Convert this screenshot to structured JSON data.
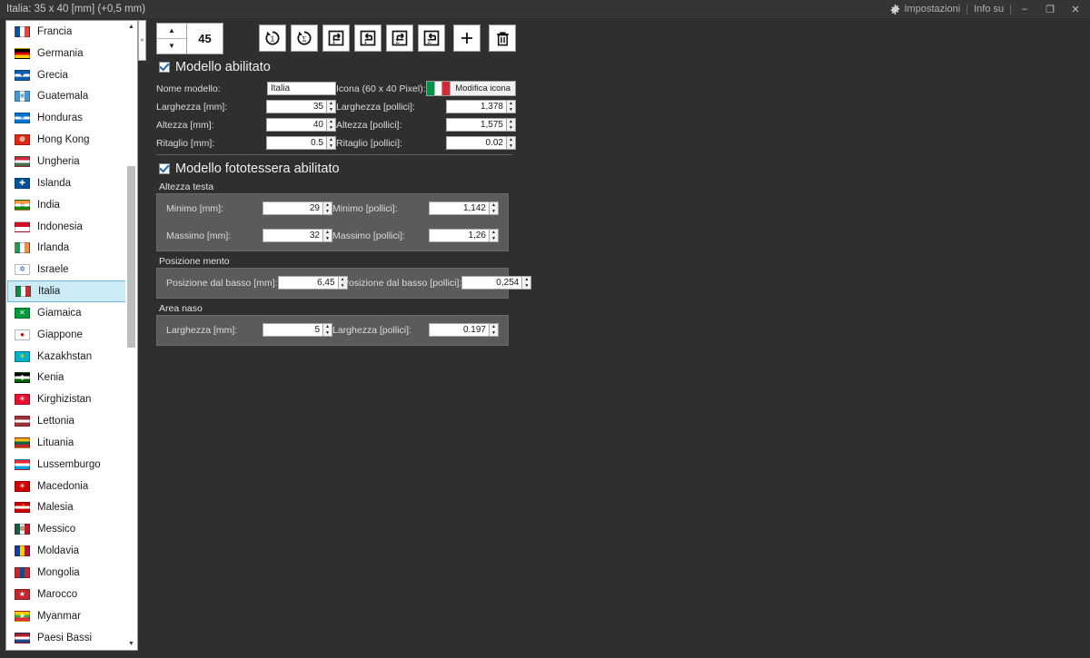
{
  "titlebar": {
    "title": "Italia: 35 x 40 [mm] (+0,5 mm)",
    "settings_label": "Impostazioni",
    "about_label": "Info su",
    "separator": "|",
    "minimize": "–",
    "restore": "❐",
    "close": "✕",
    "gear_icon": "gear-icon"
  },
  "toolbar": {
    "spinner_value": "45",
    "spin_up": "▲",
    "spin_down": "▼",
    "icons": [
      {
        "name": "reset-single-icon",
        "glyph": "reset-1"
      },
      {
        "name": "reset-all-icon",
        "glyph": "reset-sigma"
      },
      {
        "name": "export-single-icon",
        "glyph": "export-1"
      },
      {
        "name": "import-single-icon",
        "glyph": "import-1"
      },
      {
        "name": "export-all-icon",
        "glyph": "export-sigma"
      },
      {
        "name": "import-all-icon",
        "glyph": "import-sigma"
      },
      {
        "name": "add-icon",
        "glyph": "plus"
      },
      {
        "name": "delete-icon",
        "glyph": "trash"
      }
    ]
  },
  "sidebar": {
    "scroll_up": "▲",
    "scroll_down": "▼",
    "splitter_glyph": "«",
    "selected": "Italia",
    "items": [
      {
        "label": "Francia",
        "flag": "vstripe3",
        "c1": "#0055a4",
        "c2": "#ffffff",
        "c3": "#ef4135",
        "mark": ""
      },
      {
        "label": "Germania",
        "flag": "hstripe3",
        "c1": "#000000",
        "c2": "#dd0000",
        "c3": "#ffce00",
        "mark": ""
      },
      {
        "label": "Grecia",
        "flag": "hstripe3",
        "c1": "#0d5eaf",
        "c2": "#ffffff",
        "c3": "#0d5eaf",
        "mark": "✦"
      },
      {
        "label": "Guatemala",
        "flag": "vstripe3",
        "c1": "#4997d0",
        "c2": "#ffffff",
        "c3": "#4997d0",
        "mark": "❀"
      },
      {
        "label": "Honduras",
        "flag": "hstripe3",
        "c1": "#0073cf",
        "c2": "#ffffff",
        "c3": "#0073cf",
        "mark": "✳"
      },
      {
        "label": "Hong Kong",
        "flag": "plain",
        "c1": "#de2910",
        "c2": "#de2910",
        "c3": "#de2910",
        "mark": "❁"
      },
      {
        "label": "Ungheria",
        "flag": "hstripe3",
        "c1": "#cd2a3e",
        "c2": "#ffffff",
        "c3": "#436f4d",
        "mark": ""
      },
      {
        "label": "Islanda",
        "flag": "plain",
        "c1": "#02529c",
        "c2": "#02529c",
        "c3": "#02529c",
        "mark": "✚"
      },
      {
        "label": "India",
        "flag": "hstripe3",
        "c1": "#ff9933",
        "c2": "#ffffff",
        "c3": "#138808",
        "mark": "○"
      },
      {
        "label": "Indonesia",
        "flag": "hstripe2",
        "c1": "#ce1126",
        "c2": "#ffffff",
        "c3": "#ffffff",
        "mark": ""
      },
      {
        "label": "Irlanda",
        "flag": "vstripe3",
        "c1": "#169b62",
        "c2": "#ffffff",
        "c3": "#ff883e",
        "mark": ""
      },
      {
        "label": "Israele",
        "flag": "hstripe3",
        "c1": "#ffffff",
        "c2": "#ffffff",
        "c3": "#ffffff",
        "mark": "✡"
      },
      {
        "label": "Italia",
        "flag": "vstripe3",
        "c1": "#009246",
        "c2": "#ffffff",
        "c3": "#ce2b37",
        "mark": ""
      },
      {
        "label": "Giamaica",
        "flag": "plain",
        "c1": "#009b3a",
        "c2": "#009b3a",
        "c3": "#009b3a",
        "mark": "✕"
      },
      {
        "label": "Giappone",
        "flag": "plain",
        "c1": "#ffffff",
        "c2": "#ffffff",
        "c3": "#ffffff",
        "mark": "●"
      },
      {
        "label": "Kazakhstan",
        "flag": "plain",
        "c1": "#00afca",
        "c2": "#00afca",
        "c3": "#00afca",
        "mark": "☀"
      },
      {
        "label": "Kenia",
        "flag": "hstripe3",
        "c1": "#000000",
        "c2": "#ffffff",
        "c3": "#006600",
        "mark": "◆"
      },
      {
        "label": "Kirghizistan",
        "flag": "plain",
        "c1": "#e8112d",
        "c2": "#e8112d",
        "c3": "#e8112d",
        "mark": "☀"
      },
      {
        "label": "Lettonia",
        "flag": "hstripe3",
        "c1": "#9e3039",
        "c2": "#ffffff",
        "c3": "#9e3039",
        "mark": ""
      },
      {
        "label": "Lituania",
        "flag": "hstripe3",
        "c1": "#fdb913",
        "c2": "#006a44",
        "c3": "#c1272d",
        "mark": ""
      },
      {
        "label": "Lussemburgo",
        "flag": "hstripe3",
        "c1": "#ed2939",
        "c2": "#ffffff",
        "c3": "#00a1de",
        "mark": ""
      },
      {
        "label": "Macedonia",
        "flag": "plain",
        "c1": "#d20000",
        "c2": "#d20000",
        "c3": "#d20000",
        "mark": "☀"
      },
      {
        "label": "Malesia",
        "flag": "hstripe3",
        "c1": "#cc0001",
        "c2": "#ffffff",
        "c3": "#cc0001",
        "mark": "☽"
      },
      {
        "label": "Messico",
        "flag": "vstripe3",
        "c1": "#006847",
        "c2": "#ffffff",
        "c3": "#ce1126",
        "mark": "❁"
      },
      {
        "label": "Moldavia",
        "flag": "vstripe3",
        "c1": "#0046ae",
        "c2": "#ffd200",
        "c3": "#cc092f",
        "mark": ""
      },
      {
        "label": "Mongolia",
        "flag": "vstripe3",
        "c1": "#c4272f",
        "c2": "#015197",
        "c3": "#c4272f",
        "mark": ""
      },
      {
        "label": "Marocco",
        "flag": "plain",
        "c1": "#c1272d",
        "c2": "#c1272d",
        "c3": "#c1272d",
        "mark": "★"
      },
      {
        "label": "Myanmar",
        "flag": "hstripe3",
        "c1": "#fecb00",
        "c2": "#34b233",
        "c3": "#ea2839",
        "mark": "★"
      },
      {
        "label": "Paesi Bassi",
        "flag": "hstripe3",
        "c1": "#ae1c28",
        "c2": "#ffffff",
        "c3": "#21468b",
        "mark": ""
      }
    ]
  },
  "form": {
    "model_enabled": {
      "label": "Modello abilitato",
      "checked": true
    },
    "fields_left": [
      {
        "name": "nome-modello",
        "label": "Nome modello:",
        "value": "Italia",
        "type": "text"
      },
      {
        "name": "larghezza-mm",
        "label": "Larghezza [mm]:",
        "value": "35",
        "type": "number"
      },
      {
        "name": "altezza-mm",
        "label": "Altezza [mm]:",
        "value": "40",
        "type": "number"
      },
      {
        "name": "ritaglio-mm",
        "label": "Ritaglio [mm]:",
        "value": "0.5",
        "type": "number"
      }
    ],
    "icon_field": {
      "label": "Icona (60 x 40 Pixel):",
      "button_label": "Modifica icona",
      "preview": "flag-italy-icon"
    },
    "fields_right": [
      {
        "name": "larghezza-pollici",
        "label": "Larghezza [pollici]:",
        "value": "1,378"
      },
      {
        "name": "altezza-pollici",
        "label": "Altezza [pollici]:",
        "value": "1,575"
      },
      {
        "name": "ritaglio-pollici",
        "label": "Ritaglio [pollici]:",
        "value": "0.02"
      }
    ],
    "photo_enabled": {
      "label": "Modello fototessera abilitato",
      "checked": true
    },
    "groups": [
      {
        "name": "altezza-testa",
        "title": "Altezza testa",
        "rows": [
          {
            "left_label": "Minimo [mm]:",
            "left_value": "29",
            "left_name": "minimo-mm",
            "right_label": "Minimo [pollici]:",
            "right_value": "1,142",
            "right_name": "minimo-pollici"
          },
          {
            "left_label": "Massimo [mm]:",
            "left_value": "32",
            "left_name": "massimo-mm",
            "right_label": "Massimo [pollici]:",
            "right_value": "1,26",
            "right_name": "massimo-pollici"
          }
        ]
      },
      {
        "name": "posizione-mento",
        "title": "Posizione mento",
        "rows": [
          {
            "left_label": "Posizione dal basso [mm]:",
            "left_value": "6,45",
            "left_name": "posizione-dal-basso-mm",
            "right_label": "Posizione dal basso [pollici]:",
            "right_value": "0,254",
            "right_name": "posizione-dal-basso-pollici"
          }
        ]
      },
      {
        "name": "area-naso",
        "title": "Area naso",
        "rows": [
          {
            "left_label": "Larghezza [mm]:",
            "left_value": "5",
            "left_name": "area-naso-larghezza-mm",
            "right_label": "Larghezza [pollici]:",
            "right_value": "0.197",
            "right_name": "area-naso-larghezza-pollici"
          }
        ]
      }
    ]
  },
  "colors": {
    "accent": "#cdeaf7",
    "window_bg": "#2f2f2f",
    "titlebar_bg": "#353535",
    "group_bg": "#5b5b5b"
  }
}
